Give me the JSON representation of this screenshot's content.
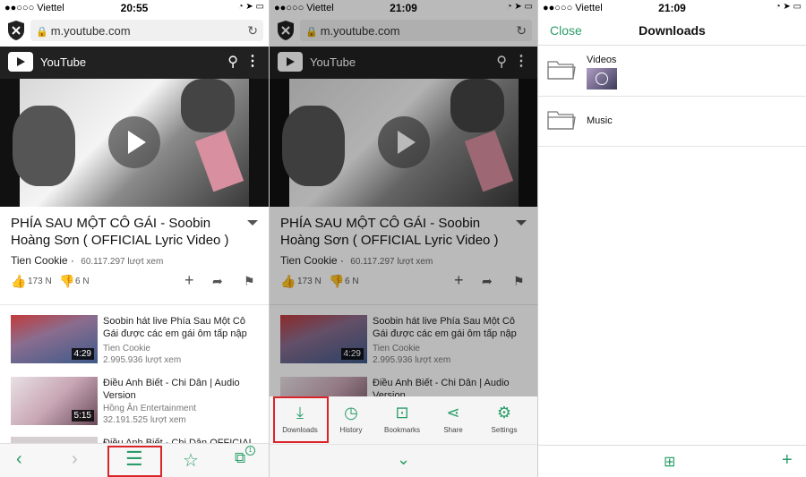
{
  "colors": {
    "accent": "#2a9d6a",
    "highlight": "#d9242a",
    "youtube_bar": "#212121"
  },
  "panel1": {
    "status": {
      "carrier": "●●○○○ Viettel",
      "time": "20:55"
    },
    "url": "m.youtube.com",
    "site_name": "YouTube",
    "video": {
      "title": "PHÍA SAU MỘT CÔ GÁI - Soobin Hoàng Sơn ( OFFICIAL Lyric Video )",
      "channel": "Tien Cookie",
      "views": "60.117.297 lượt xem",
      "likes": "173 N",
      "dislikes": "6 N"
    },
    "related": [
      {
        "title": "Soobin hát live Phía Sau Một Cô Gái được các em gái ôm tấp nập",
        "channel": "Tien Cookie",
        "views": "2.995.936 lượt xem",
        "duration": "4:29"
      },
      {
        "title": "Điều Anh Biết - Chi Dân | Audio Version",
        "channel": "Hồng Ân Entertainment",
        "views": "32.191.525 lượt xem",
        "duration": "5:15"
      },
      {
        "title": "Điều Anh Biết - Chi Dân OFFICIAL",
        "channel": "",
        "views": "",
        "duration": ""
      }
    ],
    "tab_badge": "1"
  },
  "panel2": {
    "status": {
      "carrier": "●●○○○ Viettel",
      "time": "21:09"
    },
    "url": "m.youtube.com",
    "site_name": "YouTube",
    "menu": [
      {
        "label": "Downloads",
        "icon": "download-icon"
      },
      {
        "label": "History",
        "icon": "history-icon"
      },
      {
        "label": "Bookmarks",
        "icon": "bookmark-icon"
      },
      {
        "label": "Share",
        "icon": "share-icon"
      },
      {
        "label": "Settings",
        "icon": "gear-icon"
      }
    ]
  },
  "panel3": {
    "status": {
      "carrier": "●●○○○ Viettel",
      "time": "21:09"
    },
    "close_label": "Close",
    "title": "Downloads",
    "folders": [
      {
        "name": "Videos"
      },
      {
        "name": "Music"
      }
    ]
  }
}
